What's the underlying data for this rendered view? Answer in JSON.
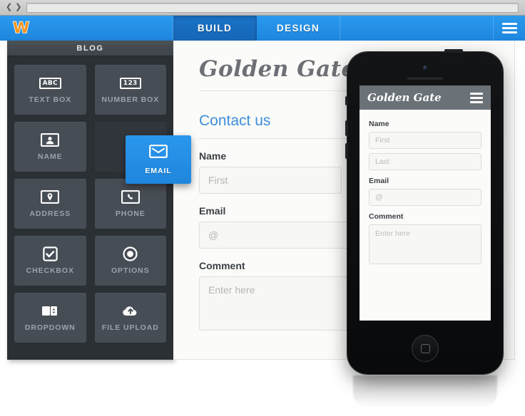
{
  "browser": {
    "back_icon": "chevron-left-icon",
    "forward_icon": "chevron-right-icon",
    "url_value": "",
    "url_placeholder": ""
  },
  "app_bar": {
    "logo_text": "W",
    "logo_color": "#f7941e",
    "bar_color": "#1e85dd",
    "active_tab_color": "#1a72c6",
    "tabs": [
      {
        "label": "BUILD",
        "active": true
      },
      {
        "label": "DESIGN",
        "active": false
      }
    ],
    "menu_icon": "hamburger-menu-icon"
  },
  "sidebar": {
    "header": "BLOG",
    "background": "#2b3035",
    "tiles": [
      {
        "label": "TEXT BOX",
        "icon": "abc-box-icon",
        "glyph": "ABC"
      },
      {
        "label": "NUMBER BOX",
        "icon": "number-box-icon",
        "glyph": "123"
      },
      {
        "label": "NAME",
        "icon": "person-card-icon",
        "glyph": "👤"
      },
      {
        "label": "",
        "icon": "empty-slot",
        "glyph": ""
      },
      {
        "label": "ADDRESS",
        "icon": "map-pin-icon",
        "glyph": "📍"
      },
      {
        "label": "PHONE",
        "icon": "phone-handset-icon",
        "glyph": "☎"
      },
      {
        "label": "CHECKBOX",
        "icon": "checkbox-icon",
        "glyph": "✔"
      },
      {
        "label": "OPTIONS",
        "icon": "radio-button-icon",
        "glyph": "◉"
      },
      {
        "label": "DROPDOWN",
        "icon": "dropdown-icon",
        "glyph": "↕"
      },
      {
        "label": "FILE UPLOAD",
        "icon": "cloud-upload-icon",
        "glyph": "☁"
      }
    ],
    "dragged_tile": {
      "label": "EMAIL",
      "icon": "envelope-icon",
      "color": "#1f86dd"
    }
  },
  "canvas": {
    "site_title": "Golden Gate",
    "contact_heading": "Contact us",
    "heading_color": "#3d8fdd",
    "fields": [
      {
        "label": "Name",
        "placeholder": "First",
        "type": "text"
      },
      {
        "label": "Email",
        "placeholder": "@",
        "type": "text"
      },
      {
        "label": "Comment",
        "placeholder": "Enter here",
        "type": "textarea"
      }
    ]
  },
  "phone": {
    "header_title": "Golden Gate",
    "header_color": "#6b7277",
    "menu_icon": "hamburger-menu-icon",
    "home_icon": "home-button-icon",
    "camera_icon": "front-camera-icon",
    "speaker_icon": "earpiece-speaker-icon",
    "fields": [
      {
        "label": "Name",
        "placeholder": "First",
        "type": "text"
      },
      {
        "label": "",
        "placeholder": "Last",
        "type": "text"
      },
      {
        "label": "Email",
        "placeholder": "@",
        "type": "text"
      },
      {
        "label": "Comment",
        "placeholder": "Enter here",
        "type": "textarea"
      }
    ]
  }
}
